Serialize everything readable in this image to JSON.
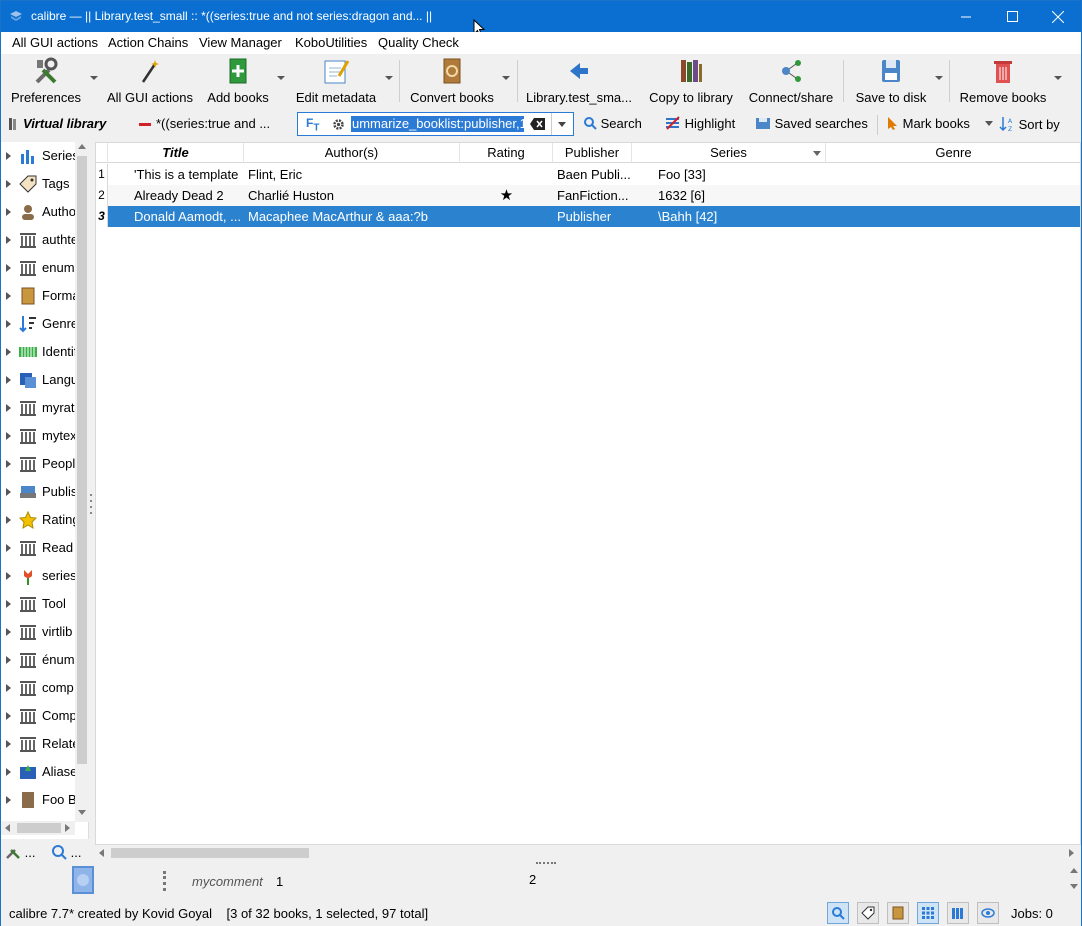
{
  "window": {
    "title": "calibre — || Library.test_small :: *((series:true and not series:dragon and... ||"
  },
  "menu": [
    "All GUI actions",
    "Action Chains",
    "View Manager",
    "KoboUtilities",
    "Quality Check"
  ],
  "toolbar": [
    {
      "label": "Preferences",
      "icon": "preferences-icon"
    },
    {
      "label": "All GUI actions",
      "icon": "magic-wand-icon"
    },
    {
      "label": "Add books",
      "icon": "add-book-icon"
    },
    {
      "label": "Edit metadata",
      "icon": "edit-metadata-icon"
    },
    {
      "label": "Convert books",
      "icon": "convert-icon"
    },
    {
      "label": "Library.test_sma...",
      "icon": "library-arrow-icon"
    },
    {
      "label": "Copy to library",
      "icon": "copy-library-icon"
    },
    {
      "label": "Connect/share",
      "icon": "network-icon"
    },
    {
      "label": "Save to disk",
      "icon": "save-disk-icon"
    },
    {
      "label": "Remove books",
      "icon": "trash-icon"
    }
  ],
  "searchbar": {
    "virtual_library": "Virtual library",
    "current_vl": "*((series:true and ...",
    "query": "ummarize_booklist:publisher,1",
    "search": "Search",
    "highlight": "Highlight",
    "saved_searches": "Saved searches",
    "mark_books": "Mark books",
    "sort_by": "Sort by"
  },
  "tag_browser": [
    "Series",
    "Tags",
    "Authors",
    "authtest",
    "enum",
    "Formats",
    "Genre",
    "Identifiers",
    "Languages",
    "myrating",
    "mytext",
    "People",
    "Publisher",
    "Rating",
    "Read",
    "series",
    "Tool",
    "virtlib",
    "énum",
    "comp",
    "Comp",
    "Related",
    "Aliases",
    "Foo Bar"
  ],
  "tag_footer": {
    "configure": "...",
    "find": "..."
  },
  "columns": [
    "Title",
    "Author(s)",
    "Rating",
    "Publisher",
    "Series",
    "Genre"
  ],
  "books": [
    {
      "num": "1",
      "title": "'This is a template",
      "authors": "Flint, Eric",
      "rating": "",
      "publisher": "Baen Publi...",
      "series": "Foo [33]",
      "genre": ""
    },
    {
      "num": "2",
      "title": "Already Dead 2",
      "authors": "Charlié Huston",
      "rating": "★",
      "publisher": "FanFiction...",
      "series": "1632 [6]",
      "genre": ""
    },
    {
      "num": "3",
      "title": "Donald Aamodt, ...",
      "authors": "Macaphee MacArthur & aaa:?b",
      "rating": "",
      "publisher": "Publisher",
      "series": "\\Bahh [42]",
      "genre": ""
    }
  ],
  "details": {
    "comment_label": "mycomment",
    "comment_value": "1",
    "center_value": "2"
  },
  "status": {
    "text": "calibre 7.7* created by Kovid Goyal    [3 of 32 books, 1 selected, 97 total]",
    "jobs": "Jobs: 0"
  },
  "colors": {
    "titlebar": "#0a6fd0",
    "selection": "#2b83cf"
  }
}
